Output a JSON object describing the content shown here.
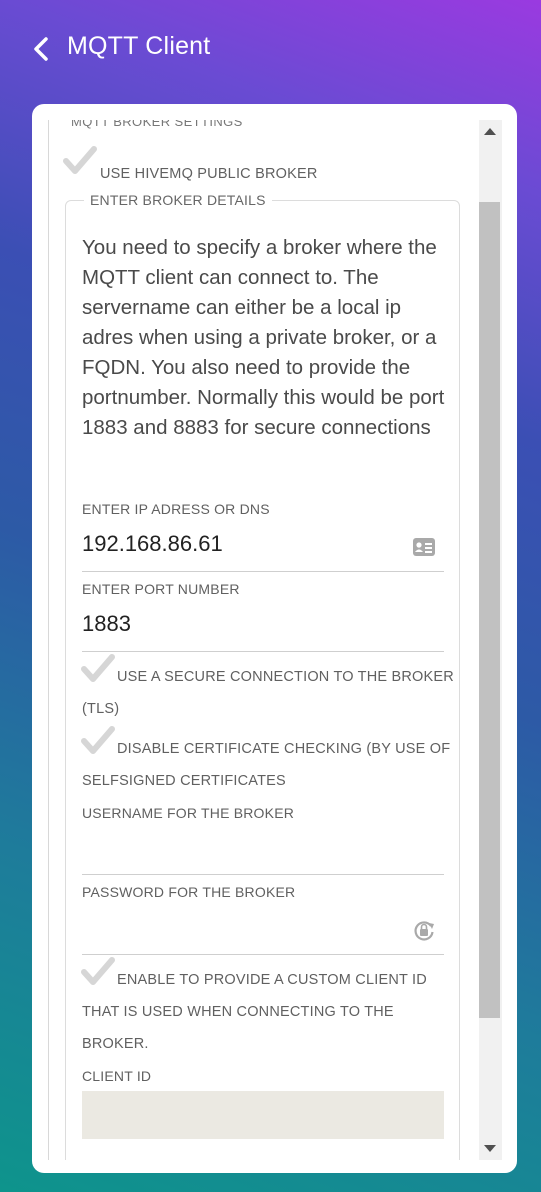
{
  "header": {
    "title": "MQTT Client",
    "back_icon": "chevron-left-icon"
  },
  "broker_settings": {
    "section_label": "MQTT BROKER SETTINGS",
    "use_public_broker_label": "USE HIVEMQ PUBLIC BROKER",
    "details_legend": "ENTER BROKER DETAILS",
    "description": "You need to specify a broker where the MQTT client can connect to. The servername can either be a local ip adres when using a private broker, or a FQDN. You also need to provide the portnumber. Normally this would be port 1883 and 8883 for secure connections",
    "ip": {
      "label": "ENTER IP ADRESS OR DNS",
      "value": "192.168.86.61",
      "icon": "contact-card-icon"
    },
    "port": {
      "label": "ENTER PORT NUMBER",
      "value": "1883"
    },
    "tls": {
      "label_line1": "USE A SECURE CONNECTION TO THE BROKER",
      "label_line2": "(TLS)"
    },
    "cert": {
      "label_line1": "DISABLE CERTIFICATE CHECKING (BY USE OF",
      "label_line2": "SELFSIGNED CERTIFICATES"
    },
    "username": {
      "label": "USERNAME FOR THE BROKER",
      "value": ""
    },
    "password": {
      "label": "PASSWORD FOR THE BROKER",
      "value": "",
      "icon": "password-lock-icon"
    },
    "custom_id": {
      "label_line1": "ENABLE TO PROVIDE A CUSTOM CLIENT ID",
      "label_line2": "THAT IS USED WHEN CONNECTING TO THE",
      "label_line3": "BROKER."
    },
    "client_id": {
      "label": "CLIENT ID",
      "value": ""
    }
  },
  "colors": {
    "accent": "#9a3ae0",
    "teal": "#0e948c",
    "checkmark": "#d6d6d6"
  }
}
